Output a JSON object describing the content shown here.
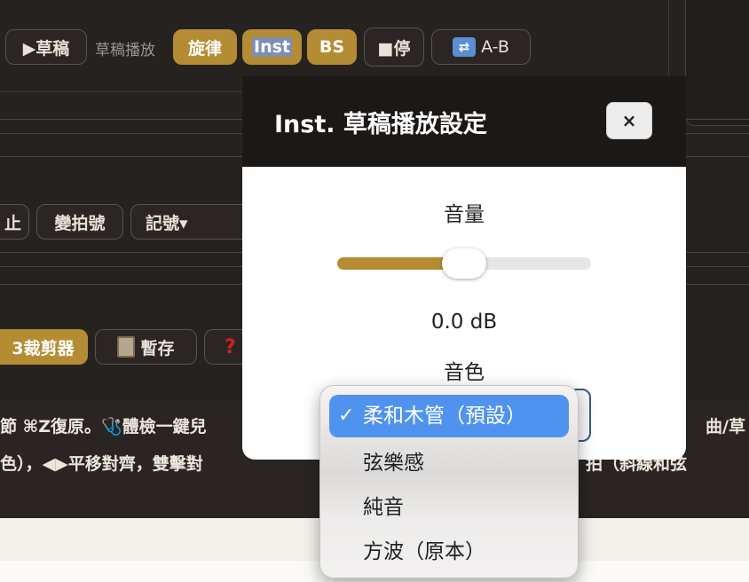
{
  "toolbar1": {
    "draft_play": "▶草稿",
    "draft_label": "草稿播放",
    "melody": "旋律",
    "inst": "Inst",
    "bs": "BS",
    "stop": "■停",
    "ab_loop": "A-B"
  },
  "toolbar2": {
    "stop_partial": "止",
    "change_meter": "變拍號",
    "markers": "記號▾"
  },
  "toolbar3": {
    "mp3_cutter_partial": "3裁剪器",
    "stash": "暫存",
    "help_icon": "?"
  },
  "instructions": {
    "line1_left": "節 ⌘Z復原。🩺體檢一鍵兒",
    "line1_right": "曲/草",
    "line2_left": "色），◀▶平移對齊，雙擊對",
    "line2_right": "拍（斜線和弦"
  },
  "modal": {
    "title": "Inst. 草稿播放設定",
    "close": "×",
    "volume_label": "音量",
    "volume_db": "0.0 dB",
    "volume_fraction": 0.5,
    "timbre_label": "音色"
  },
  "dropdown": {
    "selected_check": "✓",
    "options": [
      "柔和木管（預設）",
      "弦樂感",
      "純音",
      "方波（原本）"
    ],
    "selected_index": 0
  },
  "colors": {
    "accent": "#b48c33",
    "selection_blue": "#4f93ee"
  }
}
